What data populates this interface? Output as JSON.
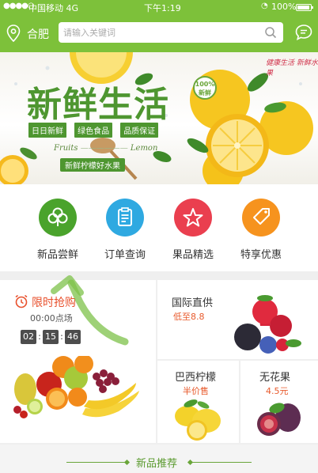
{
  "status_bar": {
    "signal": "●●●●○",
    "carrier": "中国移动 4G",
    "time": "下午1:19",
    "battery": "100%"
  },
  "header": {
    "city": "合肥",
    "search_placeholder": "请输入关键词",
    "location_icon": "location-pin-icon",
    "search_icon": "search-icon",
    "message_icon": "chat-bubble-icon"
  },
  "banner": {
    "title": "新鲜生活",
    "tags": [
      "日日新鲜",
      "绿色食品",
      "品质保证"
    ],
    "sub_left": "Fruits",
    "sub_right": "Lemon",
    "slogan": "新鲜柠檬好水果",
    "badge": "100%",
    "badge_text": "新鲜",
    "red_text": "健康生活 新鲜水果",
    "slide_count": 5
  },
  "quick_nav": [
    {
      "label": "新品尝鲜",
      "icon": "clover-icon",
      "color": "#4aa32c"
    },
    {
      "label": "订单查询",
      "icon": "clipboard-icon",
      "color": "#2fa9e1"
    },
    {
      "label": "果品精选",
      "icon": "star-icon",
      "color": "#ea3f4f"
    },
    {
      "label": "特享优惠",
      "icon": "price-tag-icon",
      "color": "#f6931e"
    }
  ],
  "promo": {
    "flash": {
      "title": "限时抢购",
      "session": "00:00点场",
      "timer": [
        "02",
        "15",
        "46"
      ]
    },
    "international": {
      "title": "国际直供",
      "sub": "低至8.8"
    },
    "lemon": {
      "title": "巴西柠檬",
      "sub": "半价售"
    },
    "fig": {
      "title": "无花果",
      "sub": "4.5元"
    }
  },
  "recommend": {
    "title": "新品推荐"
  },
  "colors": {
    "brand_green": "#7dc13a",
    "accent_orange": "#e85a2c"
  }
}
